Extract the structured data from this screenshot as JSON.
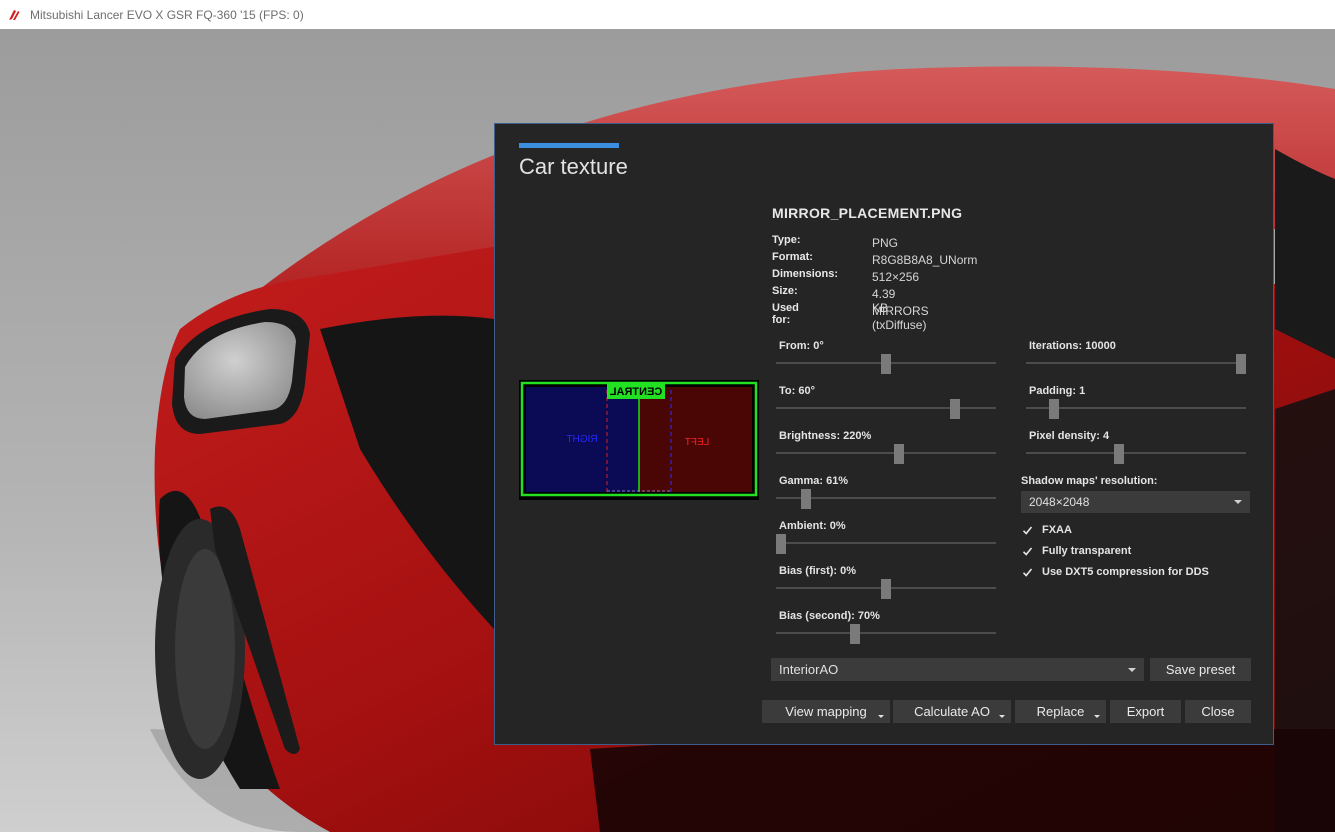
{
  "window": {
    "title": "Mitsubishi Lancer EVO X GSR FQ-360 '15 (FPS: 0)"
  },
  "dialog": {
    "title": "Car texture",
    "file_name": "MIRROR_PLACEMENT.PNG",
    "properties": [
      {
        "key": "Type:",
        "value": "PNG"
      },
      {
        "key": "Format:",
        "value": "R8G8B8A8_UNorm"
      },
      {
        "key": "Dimensions:",
        "value": "512×256"
      },
      {
        "key": "Size:",
        "value": "4.39 KB"
      },
      {
        "key": "Used for:",
        "value": "MIRRORS (txDiffuse)"
      }
    ],
    "preview": {
      "central": "CENTRAL",
      "right": "RIGHT",
      "left": "LEFT"
    },
    "sliders_left": [
      {
        "label": "From: 0°",
        "level": 0.5
      },
      {
        "label": "To: 60°",
        "level": 0.83
      },
      {
        "label": "Brightness: 220%",
        "level": 0.56
      },
      {
        "label": "Gamma: 61%",
        "level": 0.12
      },
      {
        "label": "Ambient: 0%",
        "level": 0.0
      },
      {
        "label": "Bias (first): 0%",
        "level": 0.5
      },
      {
        "label": "Bias (second): 70%",
        "level": 0.35
      }
    ],
    "sliders_right": [
      {
        "label": "Iterations: 10000",
        "level": 1.0
      },
      {
        "label": "Padding: 1",
        "level": 0.11
      },
      {
        "label": "Pixel density: 4",
        "level": 0.42
      }
    ],
    "shadow_maps_label": "Shadow maps' resolution:",
    "shadow_maps_value": "2048×2048",
    "checkboxes": [
      {
        "label": "FXAA",
        "checked": true
      },
      {
        "label": "Fully transparent",
        "checked": true
      },
      {
        "label": "Use DXT5 compression for DDS",
        "checked": true
      }
    ],
    "preset_value": "InteriorAO",
    "save_preset": "Save preset",
    "buttons": {
      "view_mapping": "View mapping",
      "calculate_ao": "Calculate AO",
      "replace": "Replace",
      "export": "Export",
      "close": "Close"
    }
  }
}
